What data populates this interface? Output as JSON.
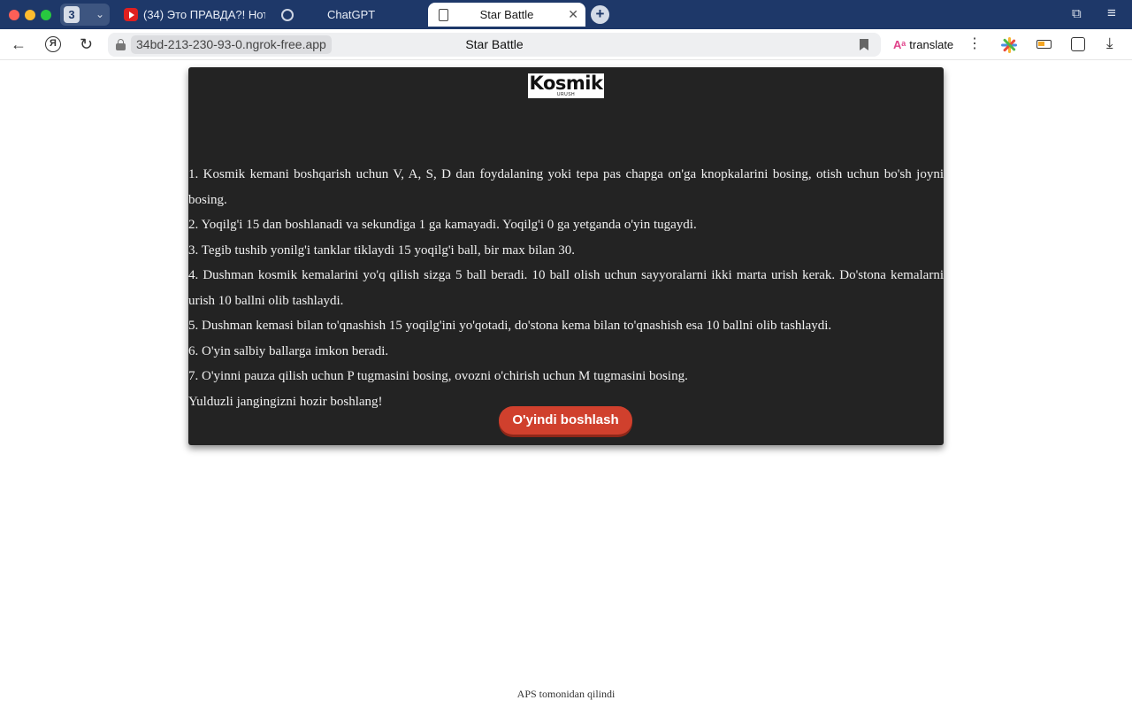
{
  "browser": {
    "tab_count": "3",
    "tabs": [
      {
        "label": "(34) Это ПРАВДА?! Нотч /"
      },
      {
        "label": "ChatGPT"
      },
      {
        "label": "Star Battle"
      }
    ],
    "url": "34bd-213-230-93-0.ngrok-free.app",
    "page_title": "Star Battle",
    "translate_label": "translate"
  },
  "page": {
    "logo_text": "Kosmik",
    "logo_sub": "URUSH",
    "rules": [
      "1. Kosmik kemani boshqarish uchun V, A, S, D dan foydalaning yoki tepa pas chapga on'ga knopkalarini bosing, otish uchun bo'sh joyni bosing.",
      "2. Yoqilg'i 15 dan boshlanadi va sekundiga 1 ga kamayadi. Yoqilg'i 0 ga yetganda o'yin tugaydi.",
      "3. Tegib tushib yonilg'i tanklar tiklaydi 15 yoqilg'i ball, bir max bilan 30.",
      "4. Dushman kosmik kemalarini yo'q qilish sizga 5 ball beradi. 10 ball olish uchun sayyoralarni ikki marta urish kerak. Do'stona kemalarni urish 10 ballni olib tashlaydi.",
      "5. Dushman kemasi bilan to'qnashish 15 yoqilg'ini yo'qotadi, do'stona kema bilan to'qnashish esa 10 ballni olib tashlaydi.",
      "6. O'yin salbiy ballarga imkon beradi.",
      "7. O'yinni pauza qilish uchun P tugmasini bosing, ovozni o'chirish uchun M tugmasini bosing.",
      "Yulduzli jangingizni hozir boshlang!"
    ],
    "start_button": "O'yindi boshlash",
    "footer": "APS tomonidan qilindi"
  },
  "colors": {
    "titlebar": "#1e3869",
    "panel": "#232323",
    "button": "#d0402d"
  }
}
